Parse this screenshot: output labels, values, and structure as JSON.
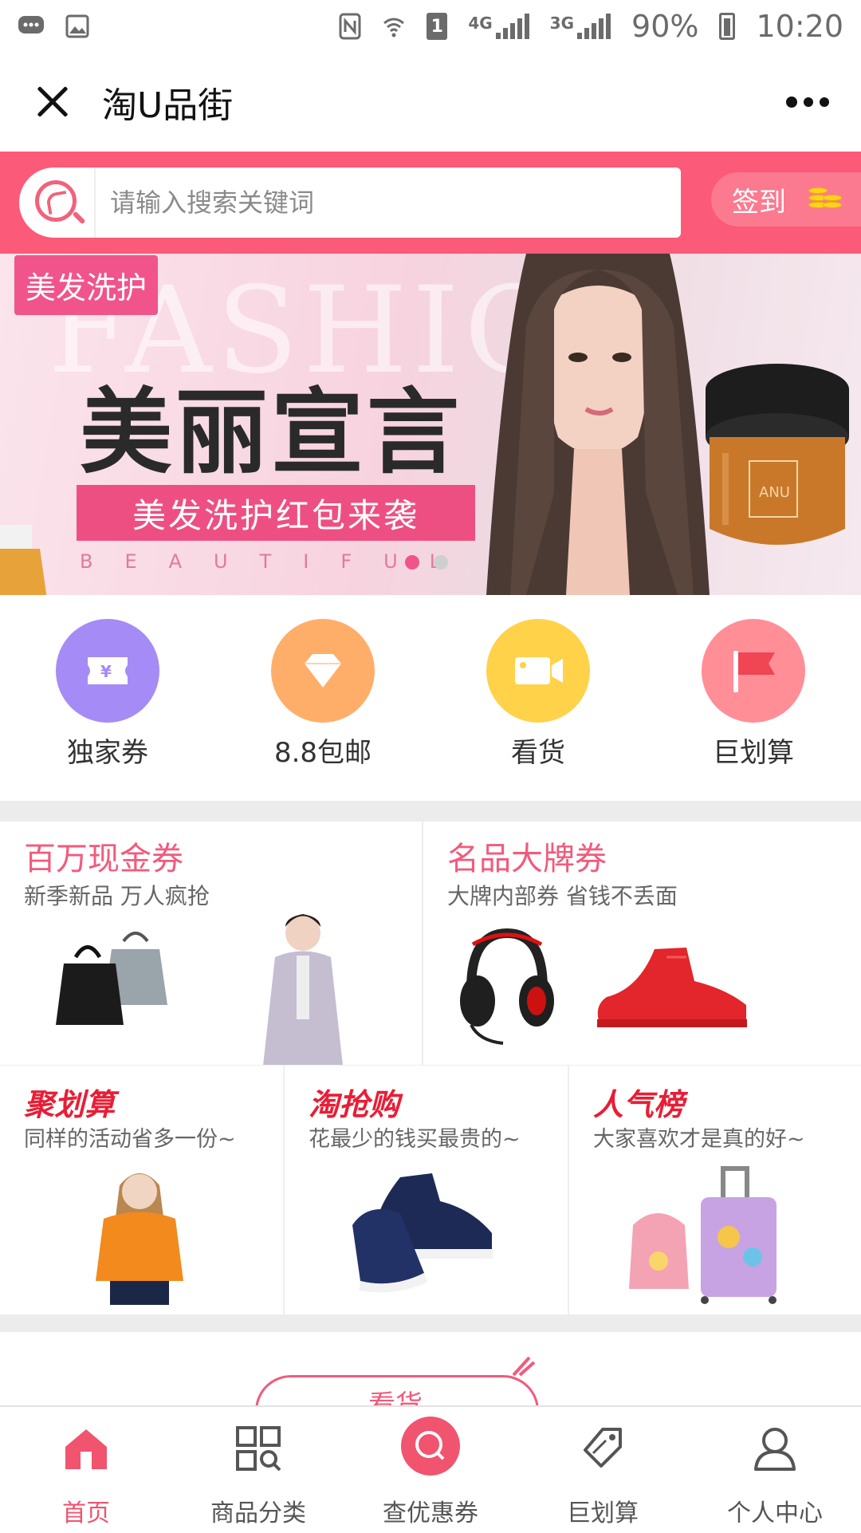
{
  "status_bar": {
    "network_4g": "4G",
    "network_3g": "3G",
    "sim_slot": "1",
    "battery": "90%",
    "time": "10:20"
  },
  "header": {
    "title": "淘U品街"
  },
  "search": {
    "placeholder": "请输入搜索关键词",
    "value": "",
    "signin_label": "签到"
  },
  "banner": {
    "tag": "美发洗护",
    "background_word": "FASHION",
    "headline": "美丽宣言",
    "ribbon": "美发洗护红包来袭",
    "spaced_text": "BEAUTIFUL",
    "jar_brand": "ANU",
    "page_count": 2,
    "active_page": 1
  },
  "quick_entries": [
    {
      "label": "独家券",
      "icon": "ticket-icon",
      "color": "#a58bf5"
    },
    {
      "label": "8.8包邮",
      "icon": "diamond-icon",
      "color": "#ffae6a"
    },
    {
      "label": "看货",
      "icon": "video-camera-icon",
      "color": "#ffd24a"
    },
    {
      "label": "巨划算",
      "icon": "flag-icon",
      "color": "#ff8e97"
    }
  ],
  "promos_big": [
    {
      "title": "百万现金券",
      "subtitle": "新季新品 万人疯抢"
    },
    {
      "title": "名品大牌券",
      "subtitle": "大牌内部券 省钱不丢面"
    }
  ],
  "promos_small": [
    {
      "title": "聚划算",
      "subtitle": "同样的活动省多一份~"
    },
    {
      "title": "淘抢购",
      "subtitle": "花最少的钱买最贵的~"
    },
    {
      "title": "人气榜",
      "subtitle": "大家喜欢才是真的好~"
    }
  ],
  "next_section": {
    "label": "看货"
  },
  "tabbar": [
    {
      "label": "首页",
      "icon": "home-icon",
      "active": true
    },
    {
      "label": "商品分类",
      "icon": "category-grid-icon",
      "active": false
    },
    {
      "label": "查优惠券",
      "icon": "coupon-search-icon",
      "active": false
    },
    {
      "label": "巨划算",
      "icon": "price-tag-icon",
      "active": false
    },
    {
      "label": "个人中心",
      "icon": "user-icon",
      "active": false
    }
  ],
  "colors": {
    "brand": "#fb5a78",
    "active_tab": "#f0546e",
    "promo_title": "#f25a7c",
    "promo_title_red": "#e81e36"
  }
}
